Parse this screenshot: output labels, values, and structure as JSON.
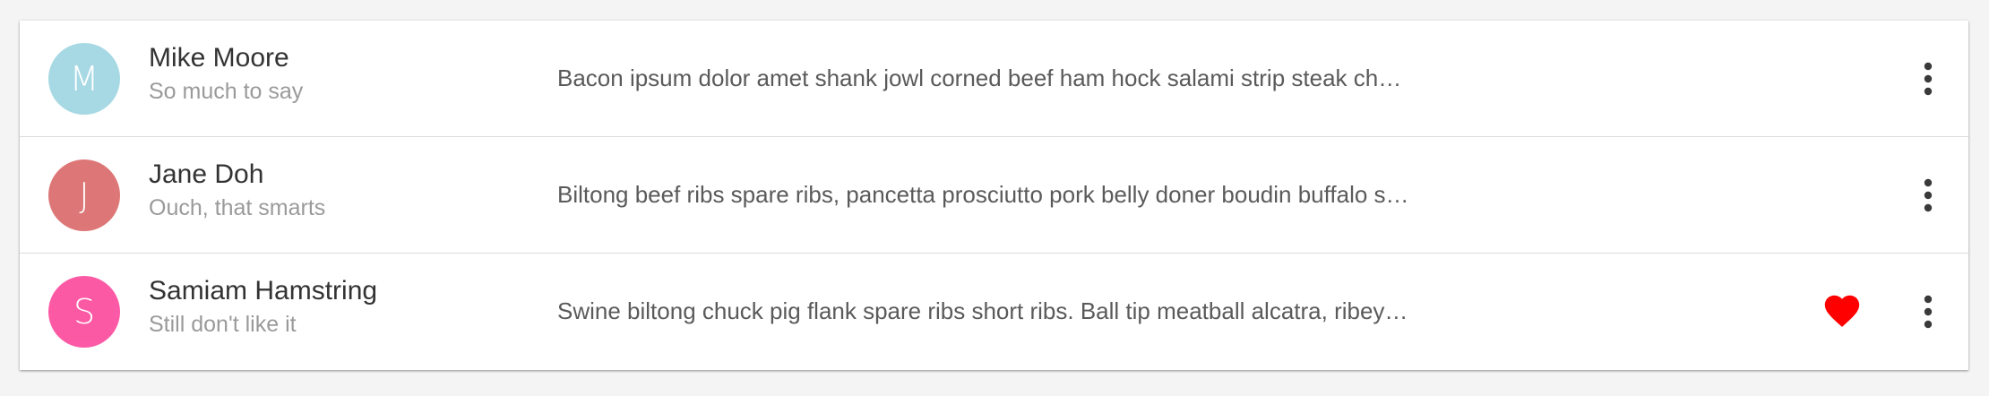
{
  "colors": {
    "page_background": "#f4f4f4",
    "card_background": "#ffffff",
    "favorite": "#ff0000"
  },
  "contacts": [
    {
      "initial": "M",
      "name": "Mike Moore",
      "subtitle": "So much to say",
      "preview": "Bacon ipsum dolor amet shank jowl corned beef ham hock salami strip steak ch…",
      "avatar_color": "#9fd6e2",
      "favorite": false,
      "menu_icon": "more-vert-icon"
    },
    {
      "initial": "J",
      "name": "Jane Doh",
      "subtitle": "Ouch, that smarts",
      "preview": "Biltong beef ribs spare ribs, pancetta prosciutto pork belly doner boudin buffalo s…",
      "avatar_color": "#db6b6b",
      "favorite": false,
      "menu_icon": "more-vert-icon"
    },
    {
      "initial": "S",
      "name": "Samiam Hamstring",
      "subtitle": "Still don't like it",
      "preview": "Swine biltong chuck pig flank spare ribs short ribs. Ball tip meatball alcatra, ribey…",
      "avatar_color": "#fc4c9e",
      "favorite": true,
      "favorite_icon": "heart-icon",
      "menu_icon": "more-vert-icon"
    }
  ]
}
